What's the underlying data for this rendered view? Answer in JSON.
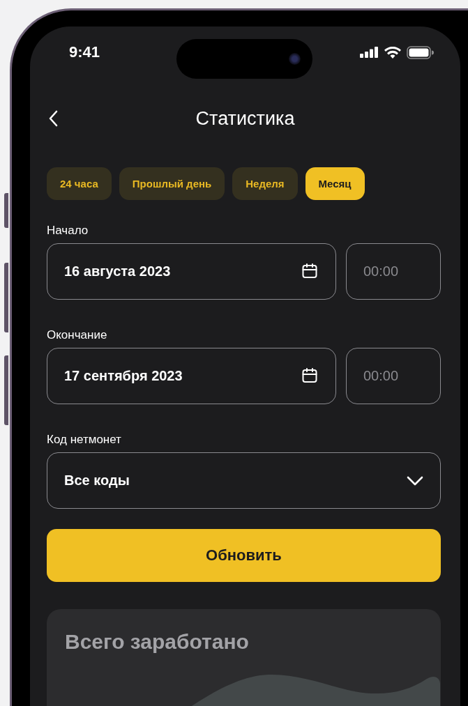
{
  "status_bar": {
    "time": "9:41"
  },
  "header": {
    "title": "Статистика"
  },
  "period_tabs": [
    {
      "label": "24 часа",
      "selected": false
    },
    {
      "label": "Прошлый день",
      "selected": false
    },
    {
      "label": "Неделя",
      "selected": false
    },
    {
      "label": "Месяц",
      "selected": true
    }
  ],
  "date_rows": [
    {
      "label": "Начало",
      "date": "16 августа 2023",
      "time_placeholder": "00:00"
    },
    {
      "label": "Окончание",
      "date": "17 сентября 2023",
      "time_placeholder": "00:00"
    }
  ],
  "code_select": {
    "label": "Код нетмонет",
    "value": "Все коды"
  },
  "refresh_button": "Обновить",
  "stats_card": {
    "title": "Всего заработано"
  }
}
